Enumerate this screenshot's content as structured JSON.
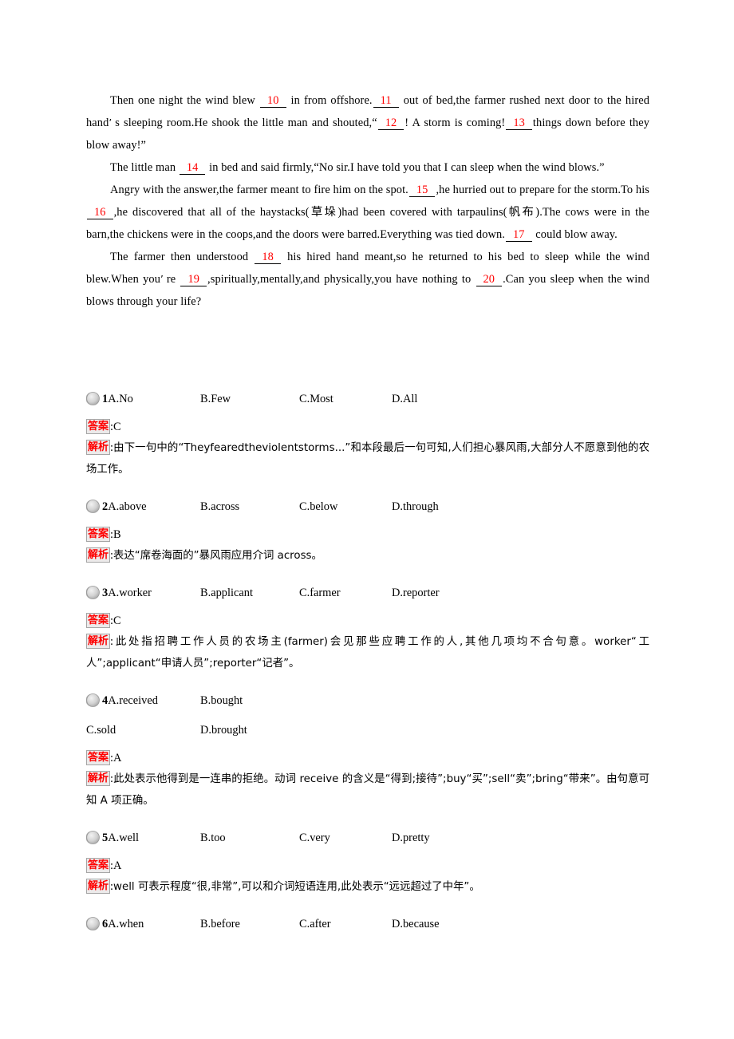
{
  "passage": {
    "paragraphs": [
      {
        "id": "p1",
        "indent": true,
        "segments": [
          {
            "t": "text",
            "v": "Then one night the wind blew "
          },
          {
            "t": "blank",
            "v": "10"
          },
          {
            "t": "text",
            "v": " in from offshore."
          },
          {
            "t": "blank",
            "v": "11"
          },
          {
            "t": "text",
            "v": " out of bed,the farmer rushed next door to the hired hand"
          },
          {
            "t": "apos",
            "v": "’"
          },
          {
            "t": "text",
            "v": "s sleeping room.He shook the little man and shouted,“"
          },
          {
            "t": "blank",
            "v": "12"
          },
          {
            "t": "text",
            "v": "! A storm is coming!"
          },
          {
            "t": "blank",
            "v": "13"
          },
          {
            "t": "text",
            "v": "things down before they blow away!”"
          }
        ]
      },
      {
        "id": "p2",
        "indent": true,
        "segments": [
          {
            "t": "text",
            "v": "The little man "
          },
          {
            "t": "blank",
            "v": "14"
          },
          {
            "t": "text",
            "v": " in bed and said firmly,“No sir.I have told you that I can sleep when the wind blows.”"
          }
        ]
      },
      {
        "id": "p3",
        "indent": true,
        "segments": [
          {
            "t": "text",
            "v": "Angry with the answer,the farmer meant to fire him on the spot."
          },
          {
            "t": "blank",
            "v": "15"
          },
          {
            "t": "text",
            "v": ",he hurried out to prepare for the storm.To his "
          },
          {
            "t": "blank",
            "v": "16"
          },
          {
            "t": "text",
            "v": ",he discovered that all of the haystacks(草垛)had been covered with tarpaulins(帆布).The cows were in the barn,the chickens were in the coops,and the doors were barred.Everything was tied down."
          },
          {
            "t": "blank",
            "v": "17"
          },
          {
            "t": "text",
            "v": " could blow away."
          }
        ]
      },
      {
        "id": "p4",
        "indent": true,
        "segments": [
          {
            "t": "text",
            "v": "The farmer then understood "
          },
          {
            "t": "blank",
            "v": "18"
          },
          {
            "t": "text",
            "v": " his hired hand meant,so he returned to his bed to sleep while the wind blew.When you"
          },
          {
            "t": "apos",
            "v": "’"
          },
          {
            "t": "text",
            "v": "re "
          },
          {
            "t": "blank",
            "v": "19"
          },
          {
            "t": "text",
            "v": ",spiritually,mentally,and physically,you have nothing to "
          },
          {
            "t": "blank",
            "v": "20"
          },
          {
            "t": "text",
            "v": ".Can you sleep when the wind blows through your life?"
          }
        ]
      }
    ]
  },
  "labels": {
    "answer_tag": "答案",
    "analysis_tag": "解析",
    "colon": ":"
  },
  "questions": [
    {
      "number": "1",
      "bullet_icon": "sphere-bullet-icon",
      "options": [
        "A.No",
        "B.Few",
        "C.Most",
        "D.All"
      ],
      "two_row_options": false,
      "answer": "C",
      "analysis_lines": [
        "由下一句中的“Theyfearedtheviolentstorms...”和本段最后一句可知,人们担心暴风雨,大部分人不愿意到他的农场工作。"
      ]
    },
    {
      "number": "2",
      "bullet_icon": "sphere-bullet-icon",
      "options": [
        "A.above",
        "B.across",
        "C.below",
        "D.through"
      ],
      "two_row_options": false,
      "answer": "B",
      "analysis_lines": [
        "表达“席卷海面的”暴风雨应用介词 across。"
      ]
    },
    {
      "number": "3",
      "bullet_icon": "sphere-bullet-icon",
      "options": [
        "A.worker",
        "B.applicant",
        "C.farmer",
        "D.reporter"
      ],
      "two_row_options": false,
      "answer": "C",
      "analysis_lines": [
        "此处指招聘工作人员的农场主(farmer)会见那些应聘工作的人,其他几项均不合句意。worker“工人”;applicant“申请人员”;reporter“记者”。"
      ]
    },
    {
      "number": "4",
      "bullet_icon": "sphere-bullet-icon",
      "options": [
        "A.received",
        "B.bought",
        "C.sold",
        "D.brought"
      ],
      "two_row_options": true,
      "answer": "A",
      "analysis_lines": [
        "此处表示他得到是一连串的拒绝。动词 receive 的含义是“得到;接待”;buy“买”;sell“卖”;bring“带来”。由句意可知 A 项正确。"
      ]
    },
    {
      "number": "5",
      "bullet_icon": "sphere-bullet-icon",
      "options": [
        "A.well",
        "B.too",
        "C.very",
        "D.pretty"
      ],
      "two_row_options": false,
      "answer": "A",
      "analysis_lines": [
        "well 可表示程度“很,非常”,可以和介词短语连用,此处表示“远远超过了中年”。"
      ]
    },
    {
      "number": "6",
      "bullet_icon": "sphere-bullet-icon",
      "options": [
        "A.when",
        "B.before",
        "C.after",
        "D.because"
      ],
      "two_row_options": false,
      "answer": null,
      "analysis_lines": []
    }
  ],
  "colors": {
    "blank_number": "#ff0000",
    "tag_text": "#ff0000",
    "tag_background": "#eceaea",
    "tag_border": "#a6a6a6",
    "body_text": "#000000"
  }
}
